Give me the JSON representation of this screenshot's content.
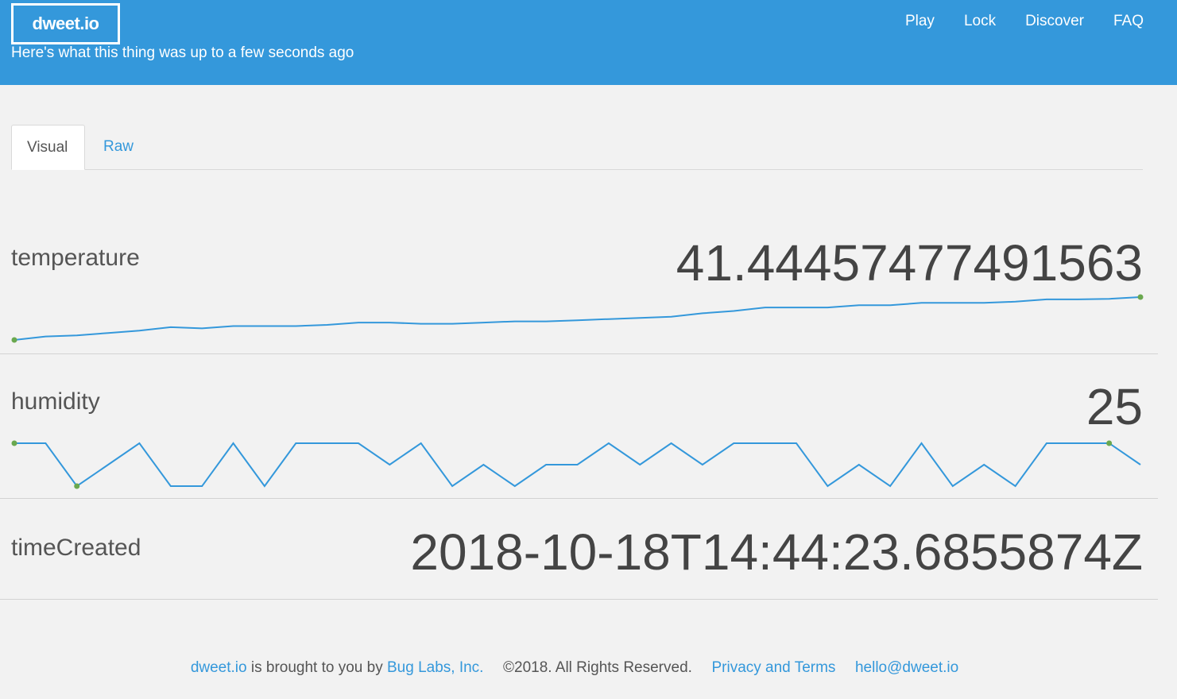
{
  "header": {
    "logo": "dweet.io",
    "subtitle": "Here's what this thing was up to a few seconds ago",
    "nav": [
      "Play",
      "Lock",
      "Discover",
      "FAQ"
    ]
  },
  "tabs": {
    "visual": "Visual",
    "raw": "Raw"
  },
  "readings": {
    "temperature": {
      "label": "temperature",
      "value": "41.4445747749156З"
    },
    "humidity": {
      "label": "humidity",
      "value": "25"
    },
    "timeCreated": {
      "label": "timeCreated",
      "value": "2018-10-18T14:44:23.6855874Z"
    }
  },
  "footer": {
    "brand": "dweet.io",
    "brought": "is brought to you by",
    "company": "Bug Labs, Inc.",
    "rights": "©2018. All Rights Reserved.",
    "privacy": "Privacy and Terms",
    "email": "hello@dweet.io"
  },
  "colors": {
    "header_bg": "#3498db",
    "sparkline": "#3498db",
    "marker": "#6aa84f",
    "page_bg": "#f2f2f2"
  },
  "chart_data": [
    {
      "type": "line",
      "series": [
        {
          "values": [
            38.0,
            38.3,
            38.4,
            38.6,
            38.8,
            39.1,
            39.0,
            39.2,
            39.2,
            39.2,
            39.3,
            39.5,
            39.5,
            39.4,
            39.4,
            39.5,
            39.6,
            39.6,
            39.7,
            39.8,
            39.9,
            40.0,
            40.3,
            40.5,
            40.8,
            40.8,
            40.8,
            41.0,
            41.0,
            41.2,
            41.2,
            41.2,
            41.3,
            41.5,
            41.5,
            41.55,
            41.7
          ]
        }
      ]
    },
    {
      "type": "line",
      "series": [
        {
          "values": [
            27,
            27,
            25,
            26,
            27,
            25,
            25,
            27,
            25,
            27,
            27,
            27,
            26,
            27,
            25,
            26,
            25,
            26,
            26,
            27,
            26,
            27,
            26,
            27,
            27,
            27,
            25,
            26,
            25,
            27,
            25,
            26,
            25,
            27,
            27,
            27,
            26
          ]
        }
      ]
    }
  ]
}
